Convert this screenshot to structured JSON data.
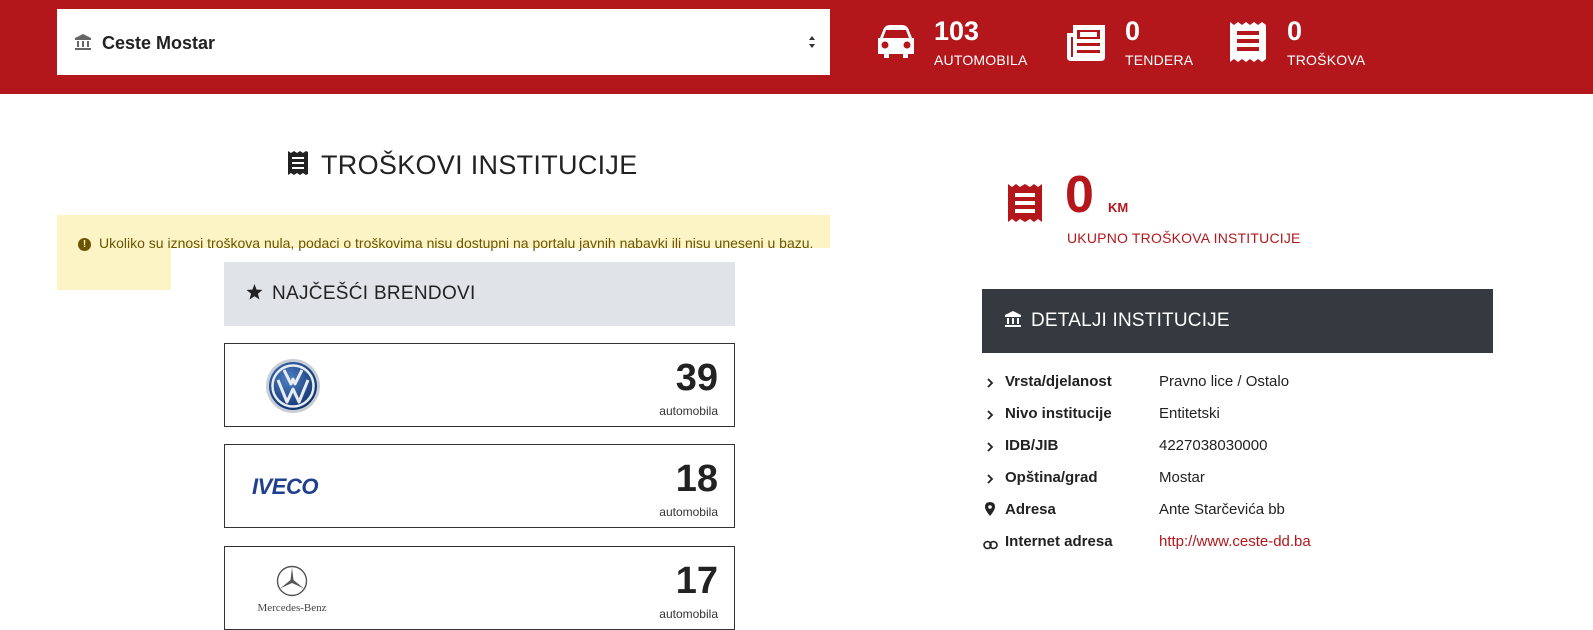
{
  "header": {
    "institution_select": {
      "value": "Ceste Mostar"
    },
    "stats": [
      {
        "value": "103",
        "label": "AUTOMOBILA",
        "icon": "car-icon"
      },
      {
        "value": "0",
        "label": "TENDERA",
        "icon": "newspaper-icon"
      },
      {
        "value": "0",
        "label": "TROŠKOVA",
        "icon": "receipt-icon"
      }
    ]
  },
  "costs": {
    "title": "TROŠKOVI INSTITUCIJE",
    "notice": "Ukoliko su iznosi troškova nula, podaci o troškovima nisu dostupni na portalu javnih nabavki ili nisu uneseni u bazu."
  },
  "brands": {
    "title": "NAJČEŠĆI BRENDOVI",
    "items": [
      {
        "name": "Volkswagen",
        "count": "39",
        "unit": "automobila"
      },
      {
        "name": "IVECO",
        "count": "18",
        "unit": "automobila"
      },
      {
        "name": "Mercedes-Benz",
        "count": "17",
        "unit": "automobila"
      }
    ]
  },
  "total": {
    "value": "0",
    "currency": "KM",
    "label": "UKUPNO TROŠKOVA INSTITUCIJE"
  },
  "details": {
    "title": "DETALJI INSTITUCIJE",
    "rows": [
      {
        "key": "Vrsta/djelanost",
        "value": "Pravno lice / Ostalo",
        "icon": "chevron-right-icon"
      },
      {
        "key": "Nivo institucije",
        "value": "Entitetski",
        "icon": "chevron-right-icon"
      },
      {
        "key": "IDB/JIB",
        "value": "4227038030000",
        "icon": "chevron-right-icon"
      },
      {
        "key": "Opština/grad",
        "value": "Mostar",
        "icon": "chevron-right-icon"
      },
      {
        "key": "Adresa",
        "value": "Ante Starčevića bb",
        "icon": "map-pin-icon"
      },
      {
        "key": "Internet adresa",
        "value": "http://www.ceste-dd.ba",
        "icon": "link-icon"
      }
    ]
  },
  "colors": {
    "brand_red": "#b3171b",
    "notice_bg": "#fdf4c6",
    "details_header_bg": "#353a40",
    "brands_header_bg": "#e0e3e8"
  }
}
